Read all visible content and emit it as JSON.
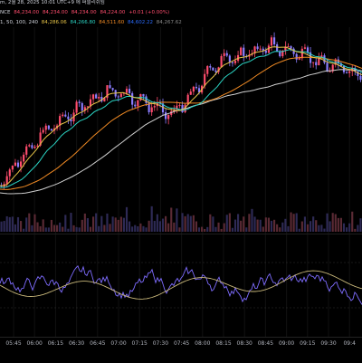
{
  "header": {
    "title": "m, 2월 28, 2025 10:01 UTC+9 에 퍼블리쉬됨",
    "ohlc": [
      "NCE",
      "84,234.00",
      "84,234.00",
      "84,234.00",
      "84,224.00",
      "+0.01 (+0.00%)"
    ],
    "ma_periods": "1, 50, 100, 240",
    "ma_values": [
      "84,286.06",
      "84,266.80",
      "84,511.60",
      "84,602.22",
      "84,267.62"
    ]
  },
  "colors": {
    "up": "#ff4d6d",
    "down": "#8b7dff",
    "ma_yellow": "#e8c547",
    "ma_cyan": "#2bd4c4",
    "ma_orange": "#f08a24",
    "ma_white": "#d0d0d0",
    "rsi": "#7e6cff",
    "rsi_signal": "#c8b77a"
  },
  "time_axis": {
    "labels": [
      "05:45",
      "06:00",
      "06:15",
      "06:30",
      "06:45",
      "07:00",
      "07:15",
      "07:30",
      "07:45",
      "08:00",
      "08:15",
      "08:30",
      "08:45",
      "09:00",
      "09:15",
      "09:30",
      "09:4"
    ]
  }
}
